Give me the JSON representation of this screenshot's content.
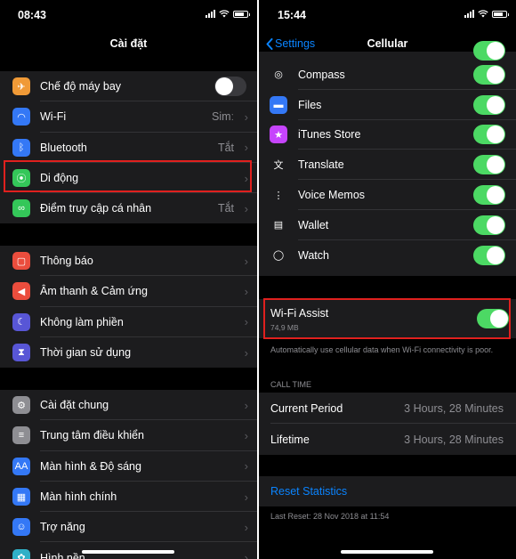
{
  "left": {
    "time": "08:43",
    "title": "Cài đặt",
    "group1": [
      {
        "label": "Chế độ máy bay",
        "icon": "airplane-icon",
        "color": "#f09a37",
        "toggle": "off"
      },
      {
        "label": "Wi-Fi",
        "icon": "wifi-icon",
        "color": "#3478f6",
        "value": "Simː"
      },
      {
        "label": "Bluetooth",
        "icon": "bluetooth-icon",
        "color": "#3478f6",
        "value": "Tắt"
      },
      {
        "label": "Di động",
        "icon": "cellular-icon",
        "color": "#34c759"
      },
      {
        "label": "Điểm truy cập cá nhân",
        "icon": "hotspot-icon",
        "color": "#34c759",
        "value": "Tắt"
      }
    ],
    "group2": [
      {
        "label": "Thông báo",
        "icon": "notifications-icon",
        "color": "#eb4d3d"
      },
      {
        "label": "Âm thanh & Cảm ứng",
        "icon": "sounds-icon",
        "color": "#eb4d3d"
      },
      {
        "label": "Không làm phiền",
        "icon": "moon-icon",
        "color": "#5856d6"
      },
      {
        "label": "Thời gian sử dụng",
        "icon": "hourglass-icon",
        "color": "#5856d6"
      }
    ],
    "group3": [
      {
        "label": "Cài đặt chung",
        "icon": "gear-icon",
        "color": "#8e8e93"
      },
      {
        "label": "Trung tâm điều khiển",
        "icon": "control-center-icon",
        "color": "#8e8e93"
      },
      {
        "label": "Màn hình & Độ sáng",
        "icon": "display-icon",
        "color": "#3478f6"
      },
      {
        "label": "Màn hình chính",
        "icon": "home-screen-icon",
        "color": "#3478f6"
      },
      {
        "label": "Trợ năng",
        "icon": "accessibility-icon",
        "color": "#3478f6"
      },
      {
        "label": "Hình nền",
        "icon": "wallpaper-icon",
        "color": "#30b0c7"
      }
    ]
  },
  "right": {
    "time": "15:44",
    "back_label": "Settings",
    "title": "Cellular",
    "apps": [
      {
        "label": "Compass",
        "icon": "compass-icon",
        "toggle": "on"
      },
      {
        "label": "Files",
        "icon": "files-icon",
        "toggle": "on"
      },
      {
        "label": "iTunes Store",
        "icon": "itunes-star-icon",
        "toggle": "on"
      },
      {
        "label": "Translate",
        "icon": "translate-icon",
        "toggle": "on"
      },
      {
        "label": "Voice Memos",
        "icon": "voice-memos-icon",
        "toggle": "on"
      },
      {
        "label": "Wallet",
        "icon": "wallet-icon",
        "toggle": "on"
      },
      {
        "label": "Watch",
        "icon": "watch-icon",
        "toggle": "on"
      }
    ],
    "wifi_assist": {
      "label": "Wi-Fi Assist",
      "usage": "74,9 MB",
      "toggle": "on"
    },
    "wifi_assist_note": "Automatically use cellular data when Wi-Fi connectivity is poor.",
    "call_time_header": "CALL TIME",
    "call_time": [
      {
        "label": "Current Period",
        "value": "3 Hours, 28 Minutes"
      },
      {
        "label": "Lifetime",
        "value": "3 Hours, 28 Minutes"
      }
    ],
    "reset_label": "Reset Statistics",
    "last_reset": "Last Reset: 28 Nov 2018 at 11:54"
  },
  "colors": {
    "accent": "#0a84ff",
    "toggle_on": "#4cd964",
    "highlight": "#e0201e"
  }
}
